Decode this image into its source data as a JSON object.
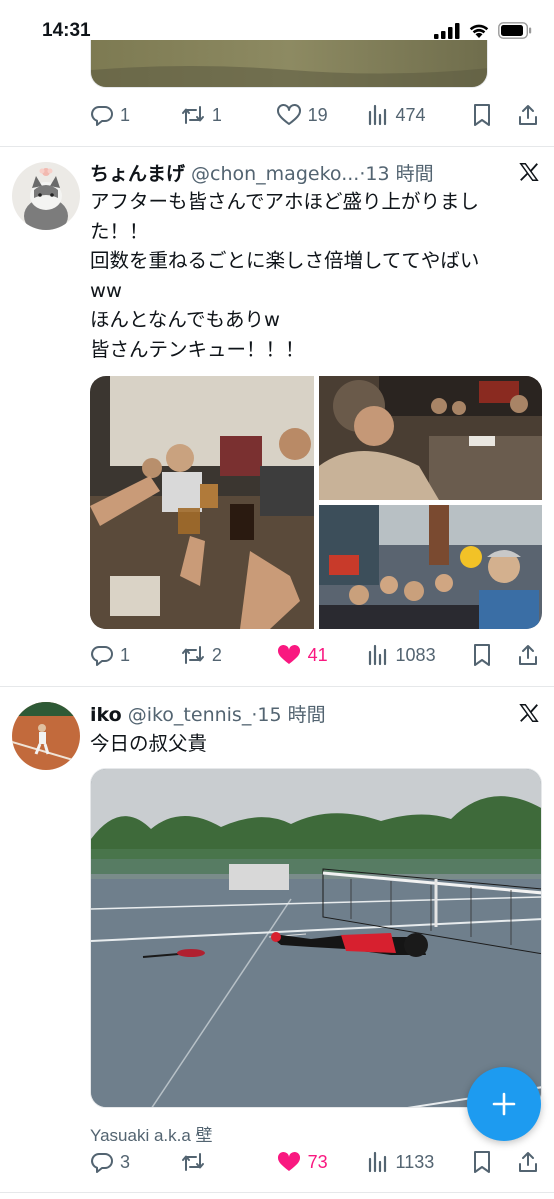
{
  "status_bar": {
    "time": "14:31"
  },
  "tweets": [
    {
      "actions": {
        "replies": "1",
        "retweets": "1",
        "likes": "19",
        "views": "474",
        "liked": false
      }
    },
    {
      "name": "ちょんまげ",
      "handle": "@chon_mageko...",
      "time": "·13 時間",
      "text_lines": [
        "アフターも皆さんでアホほど盛り上がりまし",
        "た！！",
        "回数を重ねるごとに楽しさ倍増しててやばい",
        "ww",
        "ほんとなんでもありw",
        "皆さんテンキュー！！！"
      ],
      "actions": {
        "replies": "1",
        "retweets": "2",
        "likes": "41",
        "views": "1083",
        "liked": true
      }
    },
    {
      "name": "iko",
      "handle": "@iko_tennis_",
      "time": "·15 時間",
      "text_lines": [
        "今日の叔父貴"
      ],
      "caption": "Yasuaki a.k.a 壁",
      "actions": {
        "replies": "3",
        "retweets": "",
        "likes": "73",
        "views": "1133",
        "liked": true
      }
    }
  ],
  "icons": {
    "reply": "reply-icon",
    "retweet": "retweet-icon",
    "like": "heart-icon",
    "views": "views-icon",
    "bookmark": "bookmark-icon",
    "share": "share-icon",
    "x_logo": "x-logo-icon",
    "compose": "plus-icon"
  },
  "colors": {
    "accent": "#1d9bf0",
    "like": "#f91880",
    "muted": "#536471"
  }
}
